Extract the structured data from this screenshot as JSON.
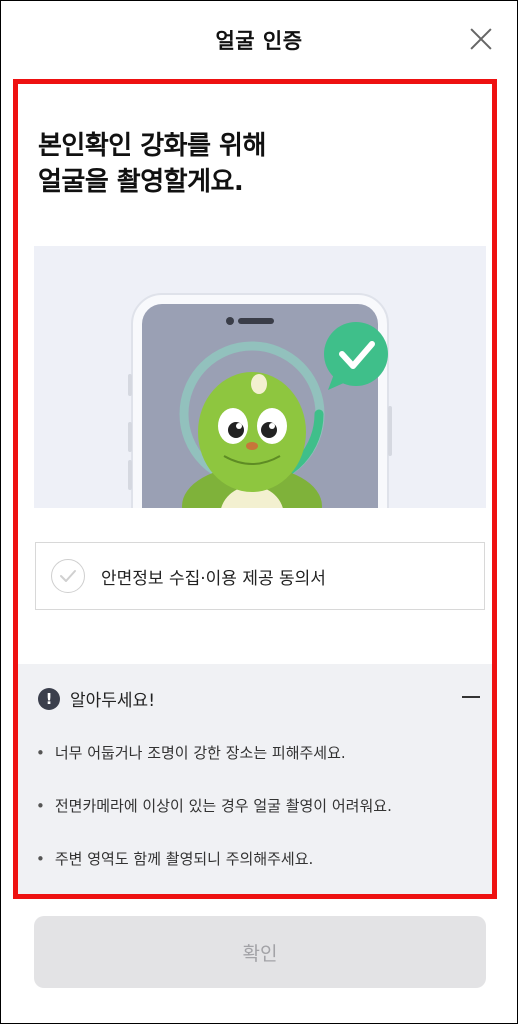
{
  "header": {
    "title": "얼굴 인증"
  },
  "main": {
    "headline_line1": "본인확인 강화를 위해",
    "headline_line2": "얼굴을 촬영할게요."
  },
  "consent": {
    "label": "안면정보 수집·이용 제공 동의서",
    "checked": false
  },
  "notice": {
    "title": "알아두세요!",
    "items": [
      "너무 어둡거나 조명이 강한 장소는 피해주세요.",
      "전면카메라에 이상이 있는 경우 얼굴 촬영이 어려워요.",
      "주변 영역도 함께 촬영되니 주의해주세요."
    ]
  },
  "footer": {
    "confirm_label": "확인",
    "confirm_enabled": false
  },
  "colors": {
    "highlight_border": "#ee1111",
    "success_green": "#3fbf8a",
    "character_green": "#8ec63f"
  },
  "icons": [
    "close-icon",
    "checkmark-icon",
    "info-icon",
    "minus-icon"
  ]
}
